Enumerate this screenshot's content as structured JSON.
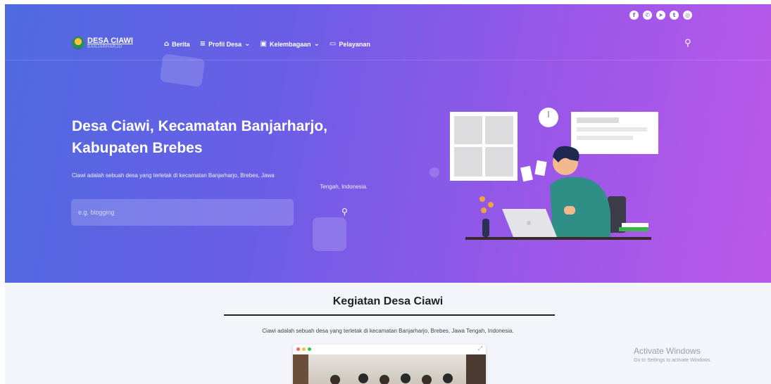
{
  "social": {
    "icons": [
      "facebook-icon",
      "whatsapp-icon",
      "telegram-icon",
      "twitter-icon",
      "instagram-icon"
    ]
  },
  "logo": {
    "title": "DESA CIAWI",
    "subtitle": "BANJARHARJO"
  },
  "nav": {
    "items": [
      {
        "label": "Berita",
        "icon": "home-icon"
      },
      {
        "label": "Profil Desa",
        "icon": "list-icon",
        "dropdown": true
      },
      {
        "label": "Kelembagaan",
        "icon": "building-icon",
        "dropdown": true
      },
      {
        "label": "Pelayanan",
        "icon": "folder-icon"
      }
    ],
    "search_icon": "search-icon"
  },
  "hero": {
    "title_line1": "Desa Ciawi, Kecamatan Banjarharjo,",
    "title_line2": "Kabupaten Brebes",
    "desc_line1": "Ciawi adalah sebuah desa yang terletak di kecamatan Banjarharjo, Brebes, Jawa",
    "desc_line2": "Tengah, Indonesia.",
    "search_placeholder": "e.g. blogging"
  },
  "section": {
    "title": "Kegiatan Desa Ciawi",
    "desc": "Ciawi adalah sebuah desa yang terletak di kecamatan Banjarharjo, Brebes, Jawa Tengah, Indonesia."
  },
  "watermark": {
    "line1": "Activate Windows",
    "line2": "Go to Settings to activate Windows."
  },
  "colors": {
    "hero_start": "#4f6ae0",
    "hero_end": "#bb58ea",
    "section_bg": "#f3f5fb"
  }
}
